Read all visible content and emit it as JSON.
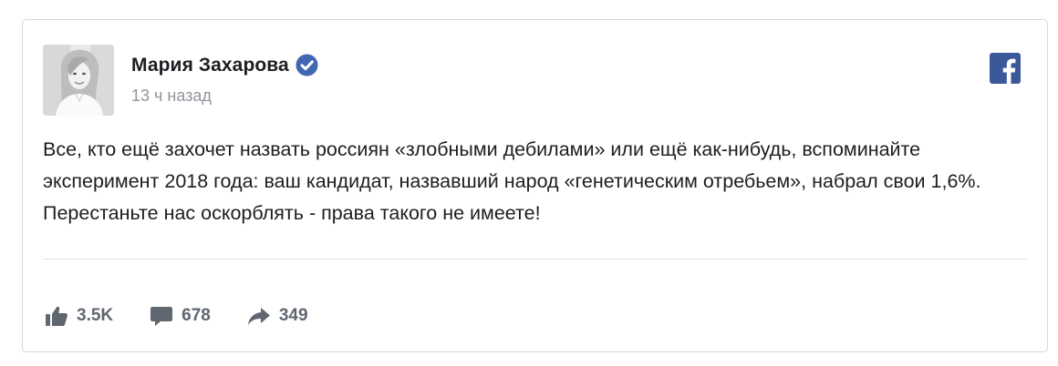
{
  "post": {
    "author": "Мария Захарова",
    "timestamp": "13 ч назад",
    "text": "Все, кто ещё захочет назвать россиян «злобными дебилами» или ещё как-нибудь, вспоминайте эксперимент 2018 года: ваш кандидат, назвавший народ «генетическим отребьем», набрал свои 1,6%. Перестаньте нас оскорблять - права такого не имеете!"
  },
  "icons": {
    "avatar": "avatar-photo",
    "verified": "verified-badge-icon",
    "platform": "facebook-logo-icon",
    "like": "thumbs-up-icon",
    "comment": "comment-bubble-icon",
    "share": "share-arrow-icon"
  },
  "stats": {
    "likes": "3.5K",
    "comments": "678",
    "shares": "349"
  },
  "colors": {
    "verified": "#4267b2",
    "facebook": "#3b5998",
    "icon_gray": "#606770",
    "meta_gray": "#90949c",
    "border": "#d6d8dd"
  }
}
